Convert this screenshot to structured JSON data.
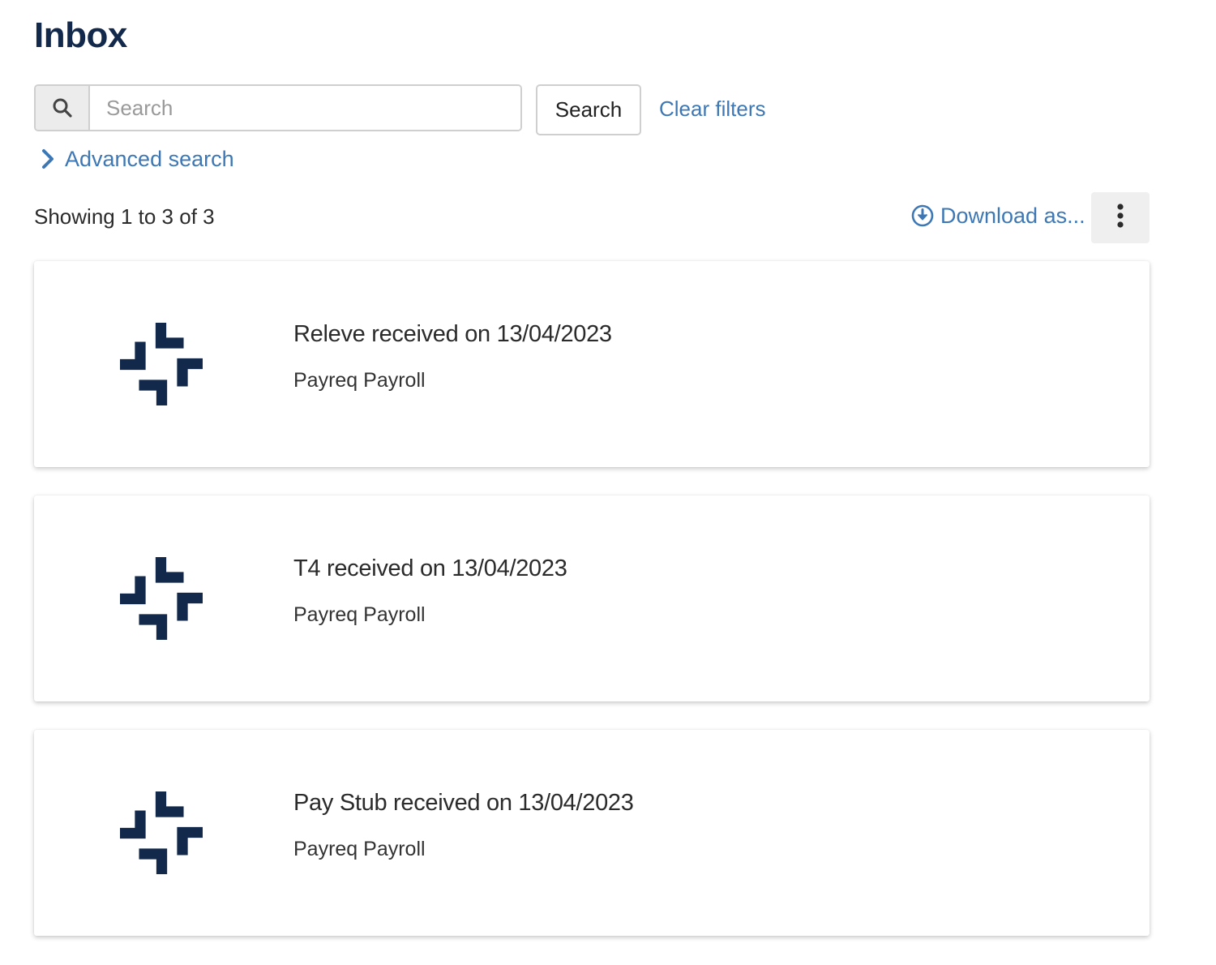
{
  "page": {
    "title": "Inbox"
  },
  "search": {
    "placeholder": "Search",
    "value": "",
    "button_label": "Search",
    "clear_label": "Clear filters",
    "advanced_label": "Advanced search"
  },
  "results": {
    "summary": "Showing 1 to 3 of 3",
    "download_label": "Download as..."
  },
  "items": [
    {
      "title": "Releve received on 13/04/2023",
      "sender": "Payreq Payroll",
      "icon": "payreq-logo-icon"
    },
    {
      "title": "T4 received on 13/04/2023",
      "sender": "Payreq Payroll",
      "icon": "payreq-logo-icon"
    },
    {
      "title": "Pay Stub received on 13/04/2023",
      "sender": "Payreq Payroll",
      "icon": "payreq-logo-icon"
    }
  ],
  "colors": {
    "title": "#13294b",
    "link": "#3d78b5",
    "logo": "#13294b",
    "border": "#cfcfcf",
    "addon_bg": "#ececec"
  }
}
